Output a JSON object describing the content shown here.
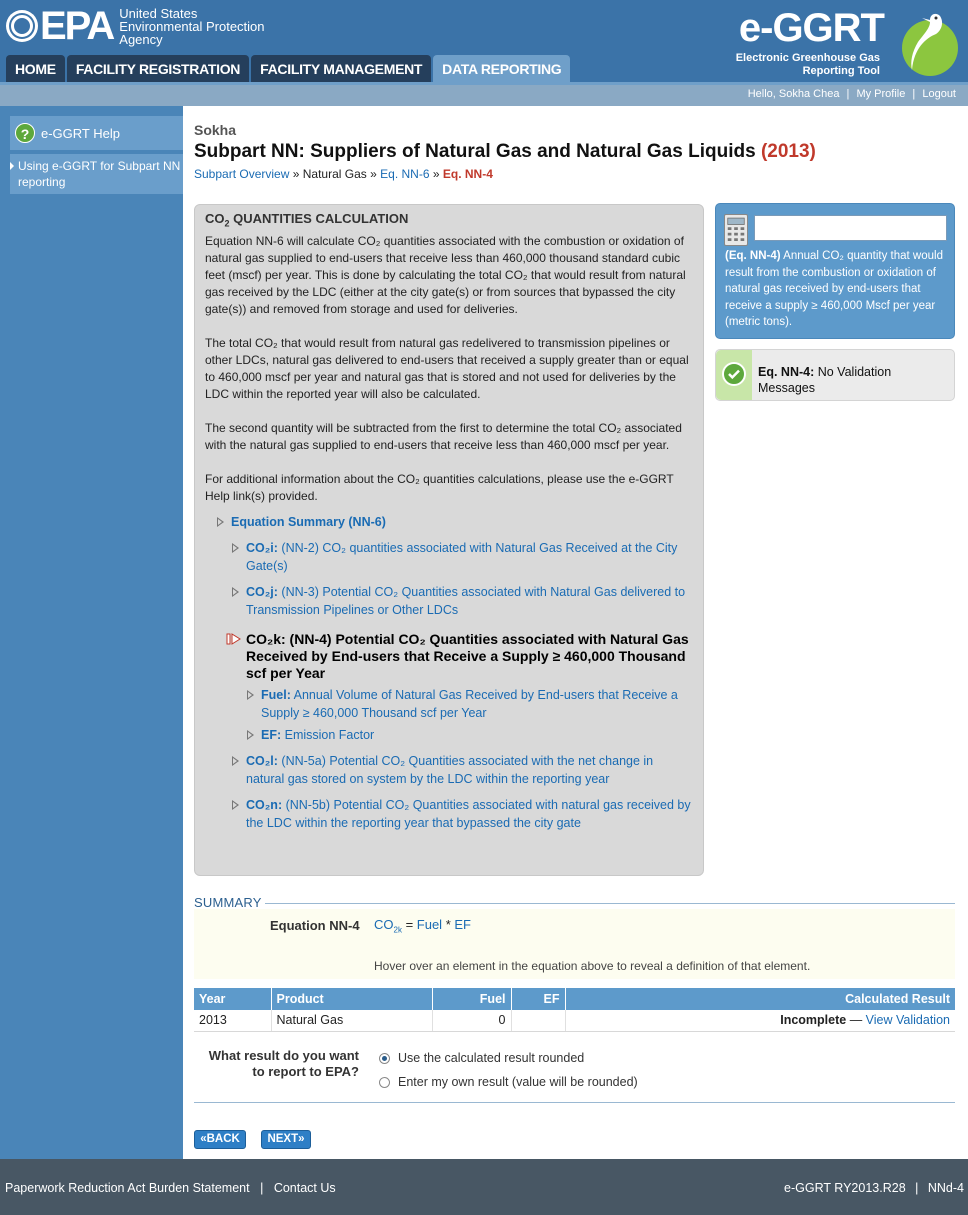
{
  "header": {
    "epa_letters": "EPA",
    "epa_name_line1": "United States",
    "epa_name_line2": "Environmental Protection",
    "epa_name_line3": "Agency",
    "eggrt_title": "e-GGRT",
    "eggrt_sub_line1": "Electronic Greenhouse Gas",
    "eggrt_sub_line2": "Reporting Tool",
    "tabs": [
      {
        "label": "HOME"
      },
      {
        "label": "FACILITY REGISTRATION"
      },
      {
        "label": "FACILITY MANAGEMENT"
      },
      {
        "label": "DATA REPORTING",
        "active": true
      }
    ]
  },
  "userbar": {
    "greeting": "Hello, Sokha Chea",
    "profile": "My Profile",
    "logout": "Logout"
  },
  "sidebar": {
    "help_label": "e-GGRT Help",
    "help_link": "Using e-GGRT for Subpart NN reporting"
  },
  "main": {
    "facility": "Sokha",
    "title": "Subpart NN: Suppliers of Natural Gas and Natural Gas Liquids",
    "year": "(2013)",
    "breadcrumb": {
      "overview": "Subpart Overview",
      "natural_gas": "Natural Gas",
      "eq6": "Eq. NN-6",
      "eq4": "Eq. NN-4",
      "sep": "»"
    },
    "calc": {
      "title_pre": "CO",
      "title_sub": "2",
      "title_post": " QUANTITIES CALCULATION",
      "p1": "Equation NN-6 will calculate CO₂ quantities associated with the combustion or oxidation of natural gas supplied to end-users that receive less than 460,000 thousand standard cubic feet (mscf) per year. This is done by calculating the total CO₂ that would result from natural gas received by the LDC (either at the city gate(s) or from sources that bypassed the city gate(s)) and removed from storage and used for deliveries.",
      "p2": "The total CO₂ that would result from natural gas redelivered to transmission pipelines or other LDCs, natural gas delivered to end-users that received a supply greater than or equal to 460,000 mscf per year and natural gas that is stored and not used for deliveries by the LDC within the reported year will also be calculated.",
      "p3": "The second quantity will be subtracted from the first to determine the total CO₂ associated with the natural gas supplied to end-users that receive less than 460,000 mscf per year.",
      "p4": "For additional information about the CO₂ quantities calculations, please use the e-GGRT Help link(s) provided.",
      "tree": {
        "summary": "Equation Summary (NN-6)",
        "co2i_code": "CO₂i:",
        "co2i_text": " (NN-2) CO₂ quantities associated with Natural Gas Received at the City Gate(s)",
        "co2j_code": "CO₂j:",
        "co2j_text": " (NN-3) Potential CO₂ Quantities associated with Natural Gas delivered to Transmission Pipelines or Other LDCs",
        "co2k_code": "CO₂k:",
        "co2k_text": " (NN-4) Potential CO₂ Quantities associated with Natural Gas Received by End-users that Receive a Supply ≥ 460,000 Thousand scf per Year",
        "fuel_code": "Fuel:",
        "fuel_text": " Annual Volume of Natural Gas Received by End-users that Receive a Supply ≥ 460,000 Thousand scf per Year",
        "ef_code": "EF:",
        "ef_text": " Emission Factor",
        "co2l_code": "CO₂l:",
        "co2l_text": " (NN-5a) Potential CO₂ Quantities associated with the net change in natural gas stored on system by the LDC within the reporting year",
        "co2n_code": "CO₂n:",
        "co2n_text": " (NN-5b) Potential CO₂ Quantities associated with natural gas received by the LDC within the reporting year that bypassed the city gate"
      }
    },
    "definition": {
      "input_value": "",
      "label": "(Eq. NN-4)",
      "text": " Annual CO₂ quantity that would result from the combustion or oxidation of natural gas received by end-users that receive a supply ≥ 460,000 Mscf per year (metric tons)."
    },
    "validation": {
      "label": "Eq. NN-4:",
      "text": " No Validation Messages"
    },
    "summary": {
      "label": "SUMMARY",
      "eq_label": "Equation NN-4",
      "eq_co": "CO",
      "eq_sub": "2k",
      "eq_eq": " = ",
      "eq_fuel": "Fuel",
      "eq_mul": " * ",
      "eq_ef": "EF",
      "hint": "Hover over an element in the equation above to reveal a definition of that element."
    },
    "table": {
      "headers": [
        "Year",
        "Product",
        "Fuel",
        "EF",
        "Calculated Result"
      ],
      "row": {
        "year": "2013",
        "product": "Natural Gas",
        "fuel": "0",
        "ef": "",
        "status": "Incomplete",
        "dash": " — ",
        "link": "View Validation"
      }
    },
    "report": {
      "question": "What result do you want to report to EPA?",
      "option1": "Use the calculated result rounded",
      "option2": "Enter my own result (value will be rounded)"
    },
    "buttons": {
      "back": "«BACK",
      "next": "NEXT»"
    }
  },
  "footer": {
    "paperwork": "Paperwork Reduction Act Burden Statement",
    "contact": "Contact Us",
    "version": "e-GGRT RY2013.R28",
    "page_code": "NNd-4",
    "sep": "|"
  },
  "colors": {
    "header_blue": "#3b73a8",
    "accent_red": "#c0392b",
    "link_blue": "#1a6bb3",
    "footer_gray": "#485764",
    "valid_green": "#5da83c"
  }
}
